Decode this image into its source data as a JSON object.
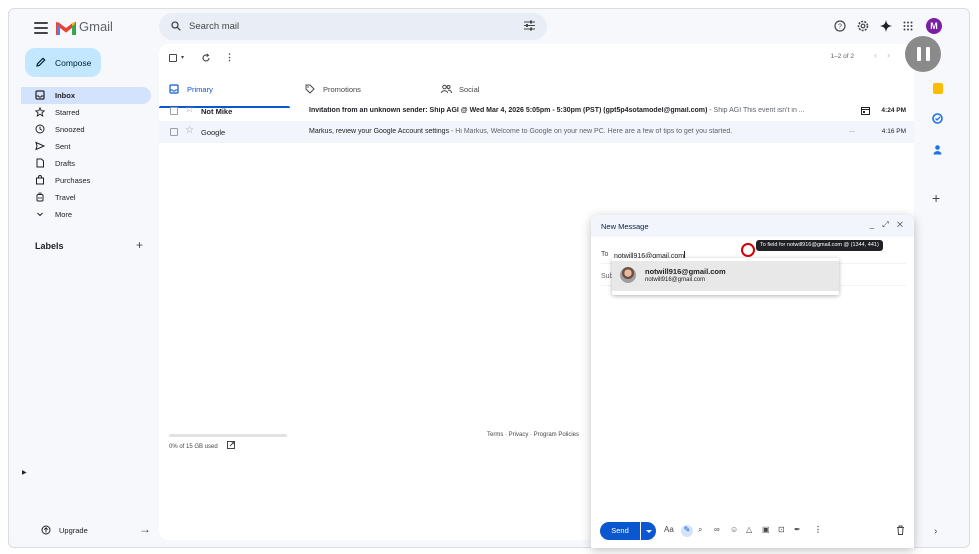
{
  "app": {
    "name": "Gmail"
  },
  "search": {
    "placeholder": "Search mail"
  },
  "account": {
    "initial": "M",
    "color": "#7b1fa2"
  },
  "compose_button": {
    "label": "Compose"
  },
  "nav": {
    "items": [
      {
        "label": "Inbox",
        "icon": "inbox-icon",
        "active": true
      },
      {
        "label": "Starred",
        "icon": "star-icon"
      },
      {
        "label": "Snoozed",
        "icon": "clock-icon"
      },
      {
        "label": "Sent",
        "icon": "send-icon"
      },
      {
        "label": "Drafts",
        "icon": "draft-icon"
      },
      {
        "label": "Purchases",
        "icon": "bag-icon"
      },
      {
        "label": "Travel",
        "icon": "luggage-icon"
      },
      {
        "label": "More",
        "icon": "chevron-down-icon"
      }
    ],
    "labels_heading": "Labels",
    "upgrade": "Upgrade"
  },
  "toolbar": {
    "pager": "1–2 of 2"
  },
  "tabs": [
    {
      "label": "Primary",
      "icon": "inbox-icon",
      "active": true
    },
    {
      "label": "Promotions",
      "icon": "tag-icon"
    },
    {
      "label": "Social",
      "icon": "people-icon"
    }
  ],
  "emails": [
    {
      "sender": "Not Mike",
      "subject": "Invitation from an unknown sender: Ship AGI @ Wed Mar 4, 2026 5:05pm - 5:30pm (PST) (gpt5p4sotamodel@gmail.com)",
      "snippet": " - Ship AGI This event isn't in ...",
      "time": "4:24 PM",
      "unread": true,
      "has_calendar": true
    },
    {
      "sender": "Google",
      "subject": "Markus, review your Google Account settings",
      "snippet": " - Hi Markus, Welcome to Google on your new PC. Here are a few of tips to get you started.",
      "trailing": "...",
      "time": "4:16 PM",
      "unread": false
    }
  ],
  "storage": {
    "text": "0% of 15 GB used",
    "fraction": 0.0
  },
  "footer": {
    "links": "Terms · Privacy · Program Policies"
  },
  "compose_window": {
    "title": "New Message",
    "controls": "_ ⤢ ✕",
    "to_label": "To",
    "to_value": "notwill916@gmail.com",
    "subject_label": "Subject",
    "send_label": "Send"
  },
  "suggestion": {
    "name": "notwill916@gmail.com",
    "email": "notwill916@gmail.com"
  },
  "annotation": {
    "tooltip": "To field for notwill916@gmail.com @ (1344, 441)"
  },
  "colors": {
    "accent": "#0b57d0",
    "compose_bg": "#c2e7ff",
    "active_nav": "#d3e3fd"
  }
}
